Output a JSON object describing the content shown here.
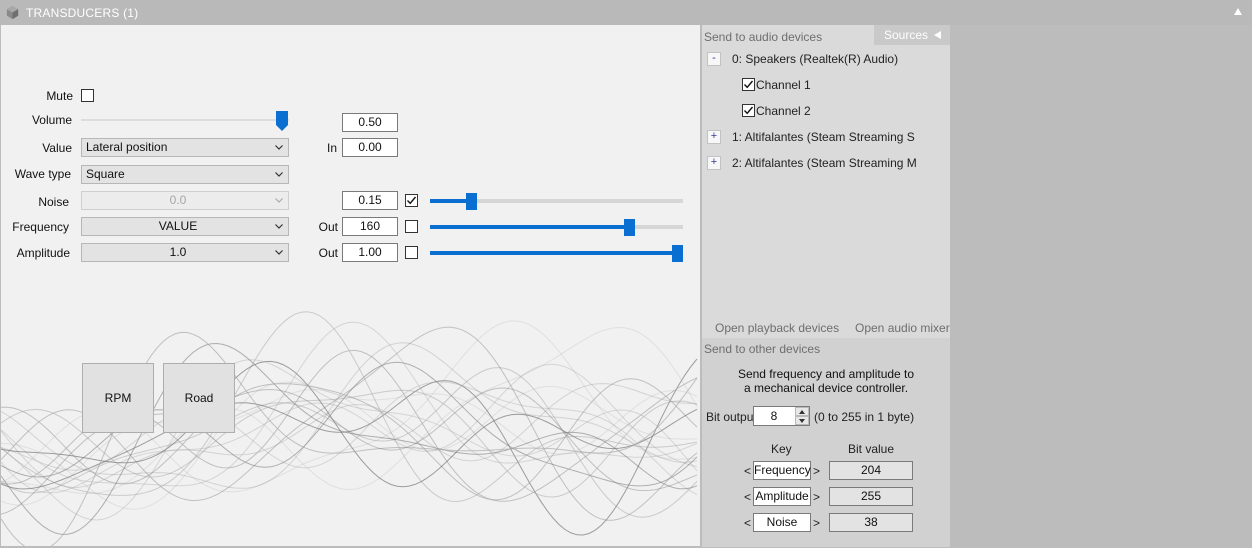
{
  "window": {
    "title": "TRANSDUCERS (1)"
  },
  "controls": {
    "mute_label": "Mute",
    "mute_checked": false,
    "volume_label": "Volume",
    "volume_value": "0.50",
    "volume_level": 1.0,
    "value_label": "Value",
    "value_selected": "Lateral position",
    "in_label": "In",
    "in_value": "0.00",
    "wave_type_label": "Wave type",
    "wave_type_selected": "Square",
    "noise_label": "Noise",
    "noise_selected": "0.0",
    "noise_value": "0.15",
    "noise_checked": true,
    "noise_level": 0.15,
    "frequency_label": "Frequency",
    "frequency_selected": "VALUE",
    "frequency_out_label": "Out",
    "frequency_value": "160",
    "frequency_checked": false,
    "frequency_level": 0.8,
    "amplitude_label": "Amplitude",
    "amplitude_selected": "1.0",
    "amplitude_out_label": "Out",
    "amplitude_value": "1.00",
    "amplitude_checked": false,
    "amplitude_level": 1.0,
    "rpm_button": "RPM",
    "road_button": "Road"
  },
  "audio": {
    "header": "Send to audio devices",
    "sources_tab": "Sources",
    "devices": [
      {
        "toggle": "-",
        "name": "0: Speakers (Realtek(R) Audio)",
        "channels": [
          {
            "name": "Channel 1",
            "checked": true
          },
          {
            "name": "Channel 2",
            "checked": true
          }
        ]
      },
      {
        "toggle": "+",
        "name": "1: Altifalantes (Steam Streaming S"
      },
      {
        "toggle": "+",
        "name": "2: Altifalantes (Steam Streaming M"
      }
    ],
    "open_playback": "Open playback devices",
    "open_mixer": "Open audio mixer"
  },
  "other": {
    "header": "Send to other devices",
    "description_line1": "Send frequency and amplitude to",
    "description_line2": "a mechanical device controller.",
    "bit_output_label": "Bit output",
    "bit_output_value": "8",
    "bit_output_hint": "(0 to 255 in 1 byte)",
    "key_header": "Key",
    "bit_value_header": "Bit value",
    "rows": [
      {
        "key": "Frequency",
        "value": "204"
      },
      {
        "key": "Amplitude",
        "value": "255"
      },
      {
        "key": "Noise",
        "value": "38"
      }
    ],
    "arrow_left": "<",
    "arrow_right": ">"
  },
  "colors": {
    "accent": "#0a6fd1",
    "panel": "#f1f1f1",
    "side_panel": "#dadada"
  }
}
